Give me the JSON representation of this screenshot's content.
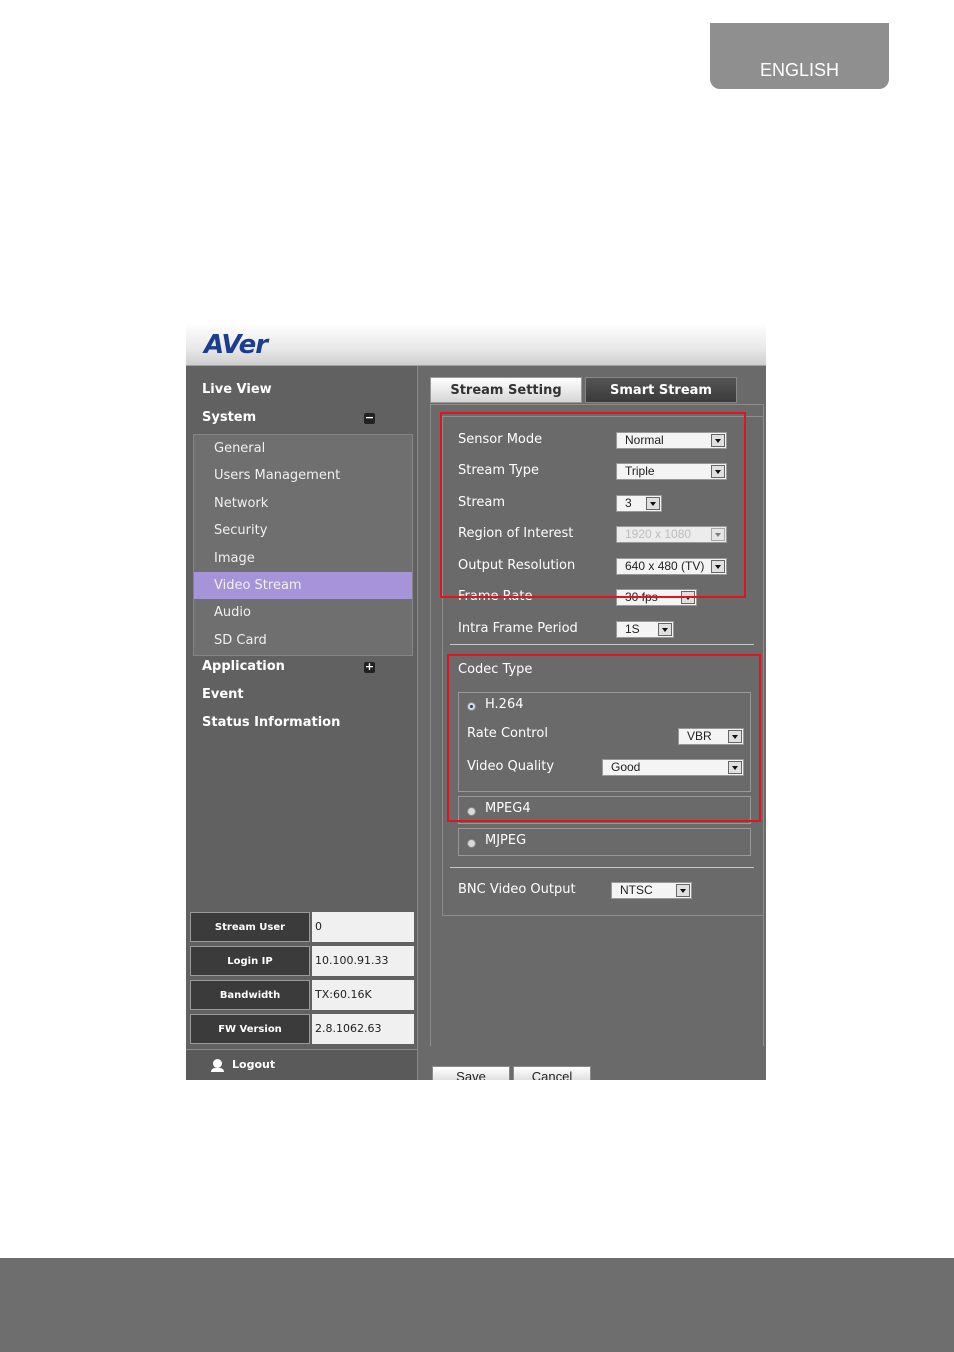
{
  "page": {
    "language_tab": "ENGLISH"
  },
  "app": {
    "logo": "AVer"
  },
  "sidebar": {
    "live_view": "Live View",
    "system": "System",
    "system_items": [
      "General",
      "Users Management",
      "Network",
      "Security",
      "Image",
      "Video Stream",
      "Audio",
      "SD Card"
    ],
    "active_item": "Video Stream",
    "application": "Application",
    "event": "Event",
    "status_information": "Status Information"
  },
  "info": [
    {
      "label": "Stream User",
      "value": "0"
    },
    {
      "label": "Login IP",
      "value": "10.100.91.33"
    },
    {
      "label": "Bandwidth",
      "value": "TX:60.16K"
    },
    {
      "label": "FW Version",
      "value": "2.8.1062.63"
    }
  ],
  "logout": "Logout",
  "tabs": {
    "stream_setting": "Stream Setting",
    "smart_stream": "Smart Stream"
  },
  "settings": {
    "sensor_mode": {
      "label": "Sensor Mode",
      "value": "Normal"
    },
    "stream_type": {
      "label": "Stream Type",
      "value": "Triple"
    },
    "stream": {
      "label": "Stream",
      "value": "3"
    },
    "roi": {
      "label": "Region of Interest",
      "value": "1920 x 1080"
    },
    "output_resolution": {
      "label": "Output Resolution",
      "value": "640 x 480 (TV)"
    },
    "frame_rate": {
      "label": "Frame Rate",
      "value": "30 fps"
    },
    "intra_frame_period": {
      "label": "Intra Frame Period",
      "value": "1S"
    }
  },
  "codec": {
    "label": "Codec Type",
    "h264": "H.264",
    "rate_control": {
      "label": "Rate Control",
      "value": "VBR"
    },
    "video_quality": {
      "label": "Video Quality",
      "value": "Good"
    },
    "mpeg4": "MPEG4",
    "mjpeg": "MJPEG",
    "selected": "H.264"
  },
  "bnc": {
    "label": "BNC Video Output",
    "value": "NTSC"
  },
  "buttons": {
    "save": "Save",
    "cancel": "Cancel"
  },
  "colors": {
    "highlight": "#e3121e",
    "active_menu": "#a594d9",
    "brand_blue": "#1c3d8f"
  }
}
